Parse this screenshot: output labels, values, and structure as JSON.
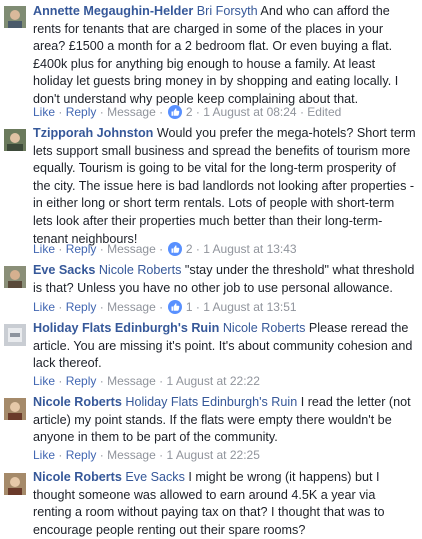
{
  "labels": {
    "like": "Like",
    "reply": "Reply",
    "message": "Message",
    "sep": "·",
    "edited": "Edited"
  },
  "comments": [
    {
      "author": "Annette Megaughin-Helder",
      "mention": "Bri Forsyth",
      "text": " And who can afford the rents for tenants that are charged in some of the places in your area? £1500 a month for a 2 bedroom flat. Or even buying a flat. £400k plus for anything big enough to house a family. At least holiday let guests bring money in by shopping and eating locally. I don't understand why people keep complaining about that.",
      "reactions": "2",
      "time": "1 August at 08:24",
      "edited": true
    },
    {
      "author": "Tzipporah Johnston",
      "mention": "",
      "text": " Would you prefer the mega-hotels? Short term lets support small business and spread the benefits of tourism more equally. Tourism is going to be vital for the long-term prosperity of the city. The issue here is bad landlords not looking after properties - in either long or short term rentals. Lots of people with short-term lets look after their properties much better than their long-term-tenant neighbours!",
      "reactions": "2",
      "time": "1 August at 13:43",
      "edited": false
    },
    {
      "author": "Eve Sacks",
      "mention": "Nicole Roberts",
      "text": " \"stay under the threshold\" what threshold is that? Unless you have no other job to use personal allowance.",
      "reactions": "1",
      "time": "1 August at 13:51",
      "edited": false
    },
    {
      "author": "Holiday Flats Edinburgh's Ruin",
      "mention": "Nicole Roberts",
      "text": " Please reread the article. You are missing it's point. It's about community cohesion and lack thereof.",
      "reactions": "",
      "time": "1 August at 22:22",
      "edited": false
    },
    {
      "author": "Nicole Roberts",
      "mention": "Holiday Flats Edinburgh's Ruin",
      "text": " I read the letter (not article) my point stands. If the flats were empty there wouldn't be anyone in them to be part of the community.",
      "reactions": "",
      "time": "1 August at 22:25",
      "edited": false
    },
    {
      "author": "Nicole Roberts",
      "mention": "Eve Sacks",
      "text": " I might be wrong (it happens) but I thought someone was allowed to earn around 4.5K a year via renting a room without paying tax on that? I thought that was to encourage people renting out their spare rooms?",
      "reactions": "",
      "time": "",
      "edited": false
    }
  ]
}
